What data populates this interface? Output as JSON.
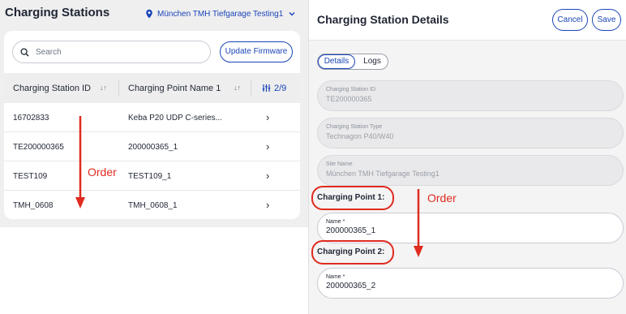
{
  "left": {
    "title": "Charging Stations",
    "site_selector": "München TMH Tiefgarage Testing1",
    "search_placeholder": "Search",
    "update_firmware_label": "Update Firmware",
    "columns": [
      {
        "label": "Charging Station ID"
      },
      {
        "label": "Charging Point Name 1"
      }
    ],
    "column_count_label": "2/9",
    "rows": [
      {
        "station_id": "16702833",
        "point_name": "Keba P20 UDP C-series..."
      },
      {
        "station_id": "TE200000365",
        "point_name": "200000365_1"
      },
      {
        "station_id": "TEST109",
        "point_name": "TEST109_1"
      },
      {
        "station_id": "TMH_0608",
        "point_name": "TMH_0608_1"
      }
    ]
  },
  "right": {
    "title": "Charging Station Details",
    "cancel_label": "Cancel",
    "save_label": "Save",
    "tabs": [
      {
        "label": "Details",
        "active": true
      },
      {
        "label": "Logs",
        "active": false
      }
    ],
    "fields": {
      "station_id": {
        "label": "Charging Station ID",
        "value": "TE200000365"
      },
      "station_type": {
        "label": "Charging Station Type",
        "value": "Technagon P40/W40"
      },
      "site_name": {
        "label": "Site Name",
        "value": "München TMH Tiefgarage Testing1"
      }
    },
    "charging_points": [
      {
        "heading": "Charging Point 1:",
        "name_label": "Name *",
        "name_value": "200000365_1"
      },
      {
        "heading": "Charging Point 2:",
        "name_label": "Name *",
        "name_value": "200000365_2"
      }
    ]
  },
  "annotations": {
    "left_order": "Order",
    "right_order": "Order",
    "color": "#e02b1f"
  },
  "colors": {
    "accent": "#1a45b8",
    "text": "#1f2533",
    "panel_bg": "#efefef"
  }
}
